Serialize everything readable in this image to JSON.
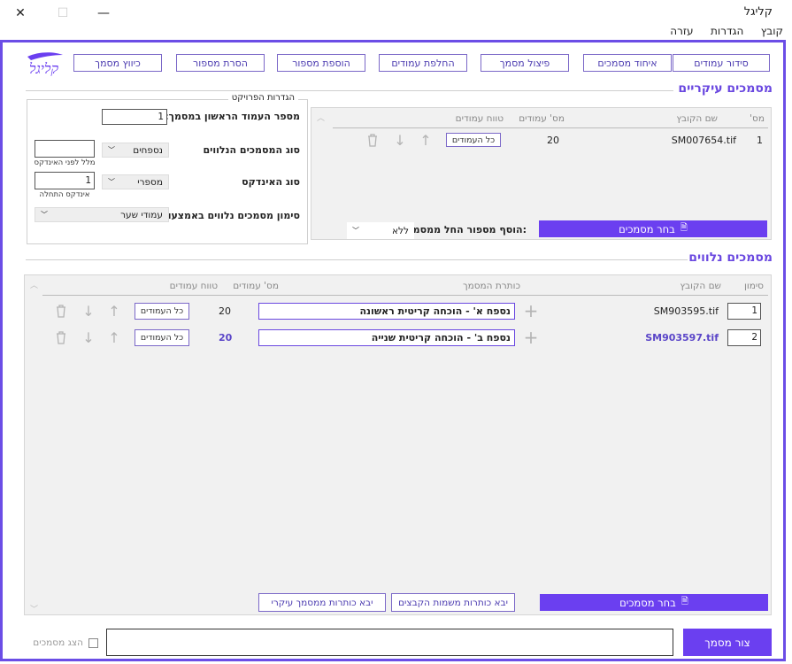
{
  "window": {
    "title": "קליגל",
    "close": "✕",
    "minimize": "—",
    "maximize": "☐"
  },
  "menu": [
    "קובץ",
    "הגדרות",
    "עזרה"
  ],
  "toolbar": {
    "logo_text": "קליגל",
    "buttons": [
      "סידור עמודים",
      "איחוד מסמכים",
      "פיצול מסמך",
      "החלפת עמודים",
      "הוספת מספור",
      "הסרת מספור",
      "כיווץ מסמך"
    ]
  },
  "main_docs": {
    "title": "מסמכים עיקריים",
    "headers": {
      "num": "מס'",
      "filename": "שם הקובץ",
      "pages": "מס' עמודים",
      "range": "טווח עמודים"
    },
    "rows": [
      {
        "num": "1",
        "filename": "SM007654.tif",
        "pages": "20",
        "range": "כל העמודים"
      }
    ],
    "add_number_label": "הוסף מספור החל ממסמך:",
    "add_number_value": "ללא",
    "choose_button": "בחר מסמכים"
  },
  "project_settings": {
    "title": "הגדרות הפרויקט",
    "first_page_label": "מספר העמוד הראשון במסמך:",
    "first_page_value": "1",
    "attached_type_label": "סוג המסמכים הנלווים",
    "attached_type_value": "נספחים",
    "delimiter_caption": "מלל לפני האינדקס",
    "delimiter_value": "",
    "index_type_label": "סוג האינדקס",
    "index_type_value": "מספרי",
    "start_index_caption": "אינדקס התחלה",
    "start_index_value": "1",
    "marking_label": "סימון מסמכים נלווים באמצעות",
    "marking_value": "עמודי שער"
  },
  "attached_docs": {
    "title": "מסמכים נלווים",
    "headers": {
      "mark": "סימון",
      "filename": "שם הקובץ",
      "doc_title": "כותרת המסמך",
      "pages": "מס' עמודים",
      "range": "טווח עמודים"
    },
    "rows": [
      {
        "mark": "1",
        "filename": "SM903595.tif",
        "doc_title": "נספח א' - הוכחה קריטית ראשונה",
        "pages": "20",
        "range": "כל העמודים",
        "highlight": false
      },
      {
        "mark": "2",
        "filename": "SM903597.tif",
        "doc_title": "נספח ב' - הוכחה קריטית שנייה",
        "pages": "20",
        "range": "כל העמודים",
        "highlight": true
      }
    ],
    "choose_button": "בחר מסמכים",
    "titles_from_files_button": "יבא כותרות משמות הקבצים",
    "titles_from_main_button": "יבא כותרות ממסמך עיקרי"
  },
  "bottom": {
    "create_button": "צור מסמך",
    "output_value": "",
    "show_docs_label": "הצג מסמכים"
  },
  "colors": {
    "accent": "#6b3ff0",
    "frame": "#6b4de6",
    "link": "#5a45c8"
  }
}
